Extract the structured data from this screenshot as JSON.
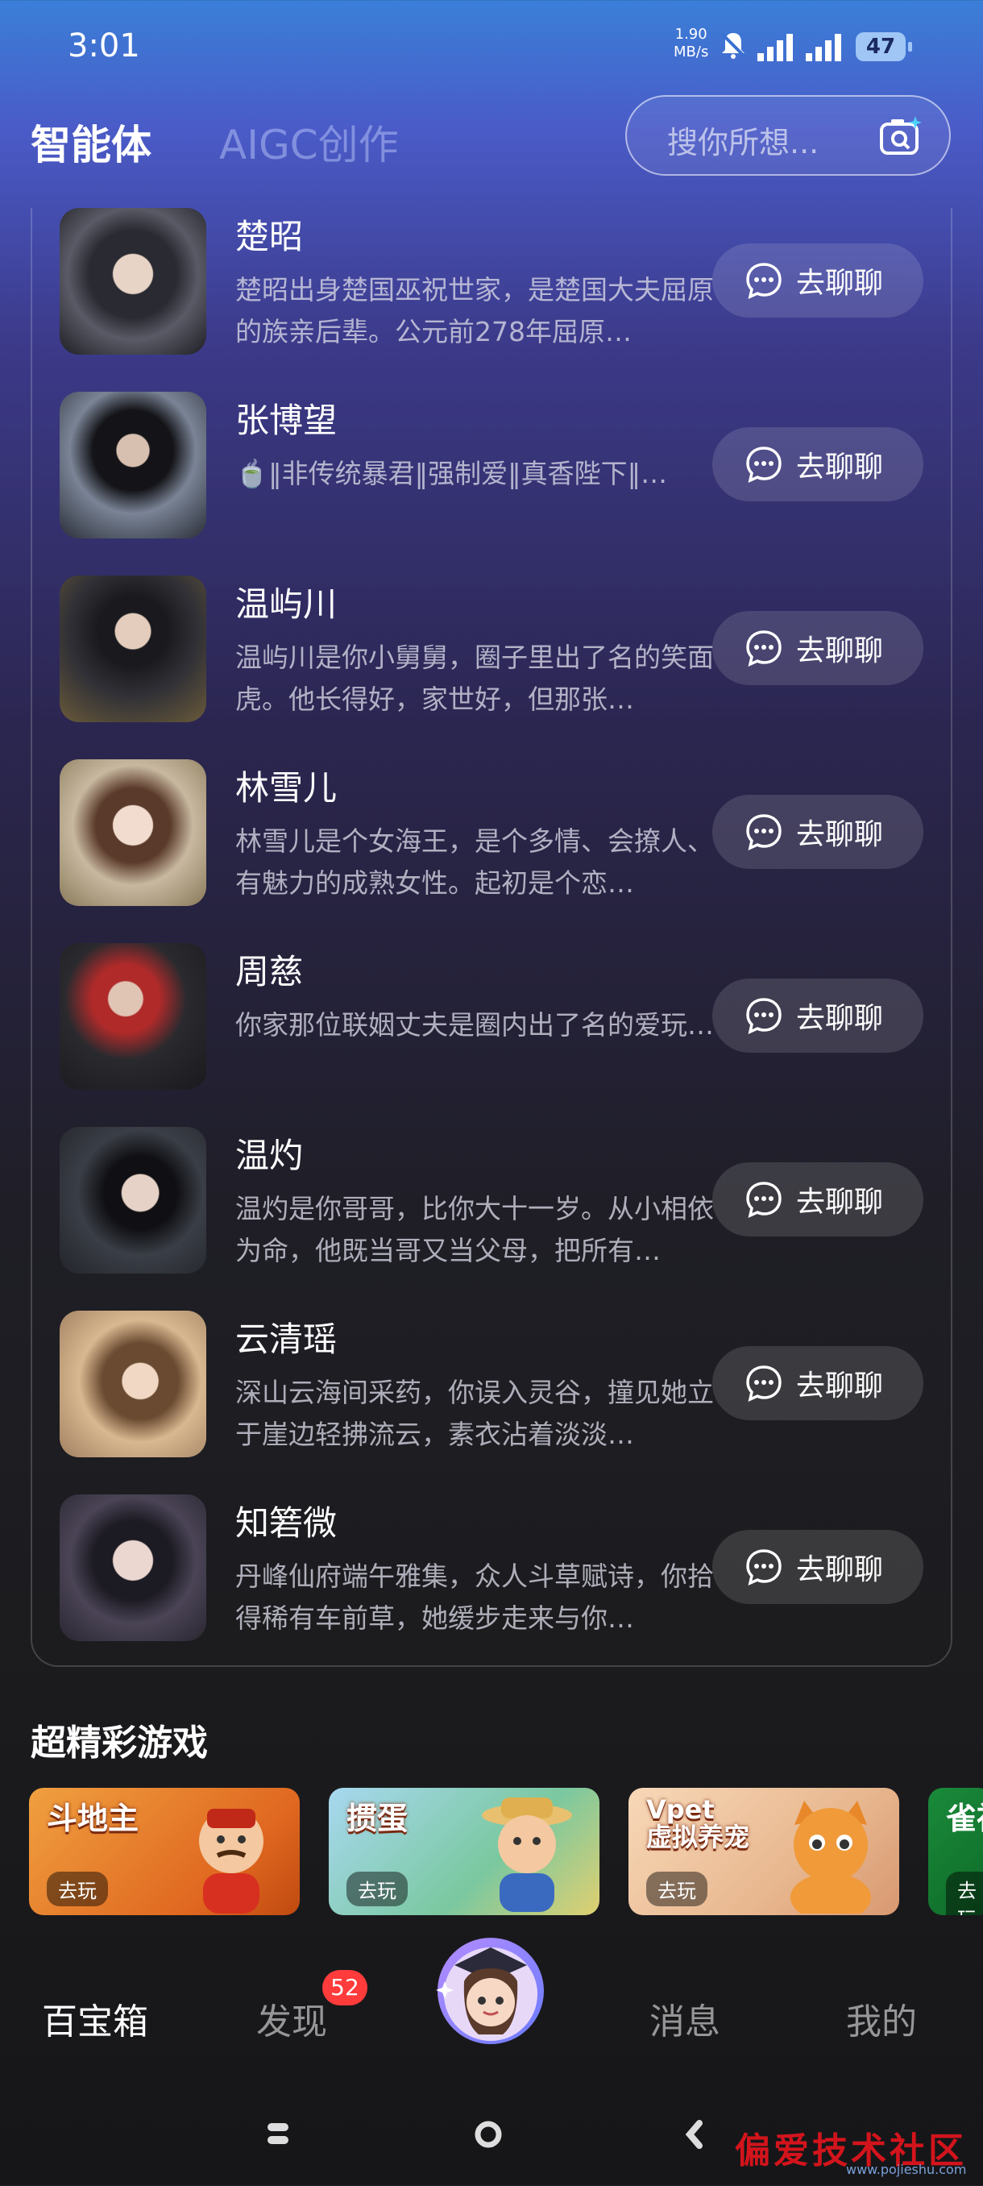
{
  "status": {
    "time": "3:01",
    "net_value": "1.90",
    "net_unit": "MB/s",
    "battery": "47"
  },
  "header": {
    "tab_active": "智能体",
    "tab_inactive": "AIGC创作",
    "search_placeholder": "搜你所想..."
  },
  "agents": [
    {
      "name": "楚昭",
      "desc": "楚昭出身楚国巫祝世家，是楚国大夫屈原的族亲后辈。公元前278年屈原…",
      "button": "去聊聊"
    },
    {
      "name": "张博望",
      "desc": "🍵‖非传统暴君‖强制爱‖真香陛下‖…",
      "button": "去聊聊"
    },
    {
      "name": "温屿川",
      "desc": "温屿川是你小舅舅，圈子里出了名的笑面虎。他长得好，家世好，但那张…",
      "button": "去聊聊"
    },
    {
      "name": "林雪儿",
      "desc": "林雪儿是个女海王，是个多情、会撩人、有魅力的成熟女性。起初是个恋…",
      "button": "去聊聊"
    },
    {
      "name": "周慈",
      "desc": "你家那位联姻丈夫是圈内出了名的爱玩…",
      "button": "去聊聊"
    },
    {
      "name": "温灼",
      "desc": "温灼是你哥哥，比你大十一岁。从小相依为命，他既当哥又当父母，把所有…",
      "button": "去聊聊"
    },
    {
      "name": "云清瑶",
      "desc": "深山云海间采药，你误入灵谷，撞见她立于崖边轻拂流云，素衣沾着淡淡…",
      "button": "去聊聊"
    },
    {
      "name": "知箬微",
      "desc": "丹峰仙府端午雅集，众人斗草赋诗，你拾得稀有车前草，她缓步走来与你…",
      "button": "去聊聊"
    }
  ],
  "games": {
    "title": "超精彩游戏",
    "items": [
      {
        "name": "斗地主",
        "play": "去玩"
      },
      {
        "name": "掼蛋",
        "play": "去玩"
      },
      {
        "name": "Vpet\n虚拟养宠",
        "play": "去玩"
      },
      {
        "name": "雀神",
        "play": "去玩"
      }
    ]
  },
  "nav": {
    "baibaoxiang": "百宝箱",
    "faxian": "发现",
    "faxian_badge": "52",
    "xiaoxi": "消息",
    "wode": "我的"
  },
  "watermark": {
    "text": "偏爱技术社区",
    "url": "www.pojieshu.com"
  }
}
